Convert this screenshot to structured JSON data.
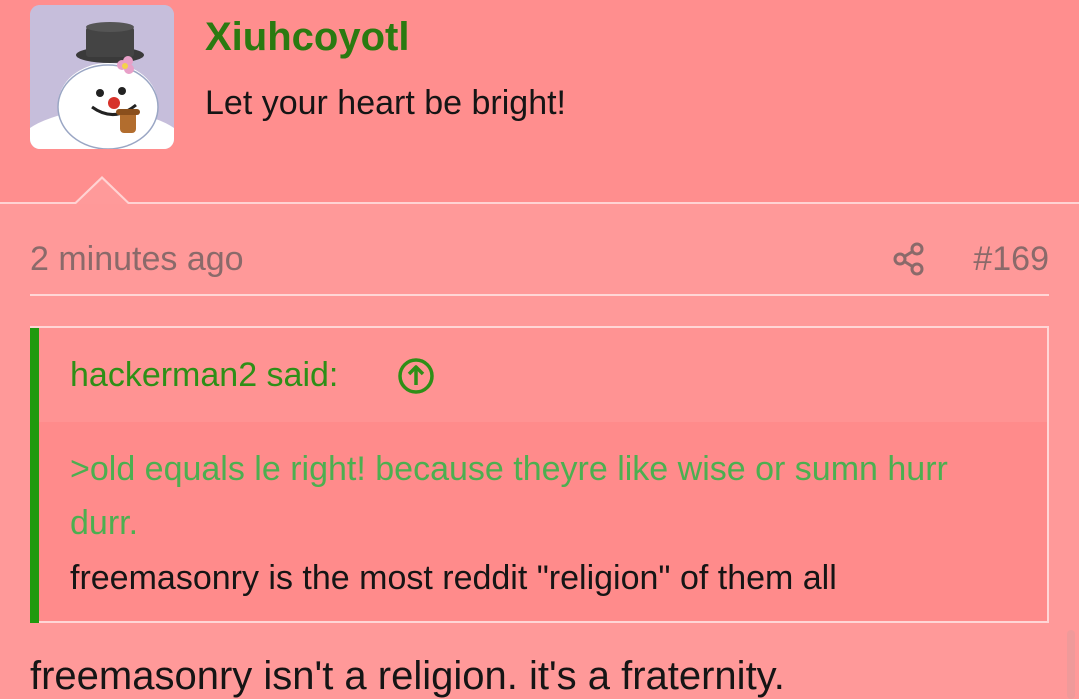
{
  "user": {
    "name": "Xiuhcoyotl",
    "title": "Let your heart be bright!",
    "avatar_icon": "snowman-avatar-icon"
  },
  "post": {
    "time": "2 minutes ago",
    "number": "#169",
    "share_icon": "share-icon"
  },
  "quote": {
    "author_line": "hackerman2 said:",
    "jump_icon": "arrow-up-circle-icon",
    "greentext": ">old equals le right! because theyre like wise or sumn hurr durr.",
    "text": "freemasonry is the most reddit \"religion\" of them all"
  },
  "reply": {
    "text": "freemasonry isn't a religion. it's a fraternity."
  },
  "colors": {
    "header_bg": "#ff8e8e",
    "page_bg": "#ff9999",
    "username": "#2a7a11",
    "quote_accent": "#1f9a0e",
    "greentext": "#4caf50",
    "meta_text": "#8a6a6a"
  }
}
